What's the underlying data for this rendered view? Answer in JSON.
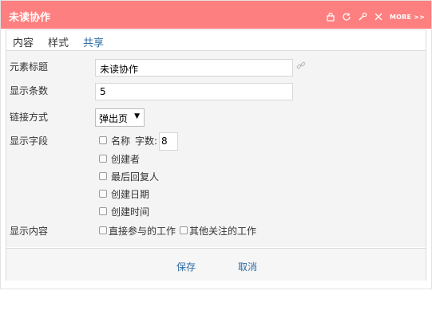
{
  "window": {
    "title": "未读协作",
    "more_label": "MORE >>"
  },
  "tabs": [
    {
      "label": "内容"
    },
    {
      "label": "样式"
    },
    {
      "label": "共享"
    }
  ],
  "form": {
    "title_label": "元素标题",
    "title_value": "未读协作",
    "count_label": "显示条数",
    "count_value": "5",
    "link_label": "链接方式",
    "link_selected": "弹出页",
    "fields_label": "显示字段",
    "fields": [
      {
        "label": "名称"
      },
      {
        "label": "创建者"
      },
      {
        "label": "最后回复人"
      },
      {
        "label": "创建日期"
      },
      {
        "label": "创建时间"
      }
    ],
    "char_count_label": "字数:",
    "char_count_value": "8",
    "content_label": "显示内容",
    "content_options": [
      {
        "label": "直接参与的工作"
      },
      {
        "label": "其他关注的工作"
      }
    ]
  },
  "footer": {
    "save_label": "保存",
    "cancel_label": "取消"
  }
}
